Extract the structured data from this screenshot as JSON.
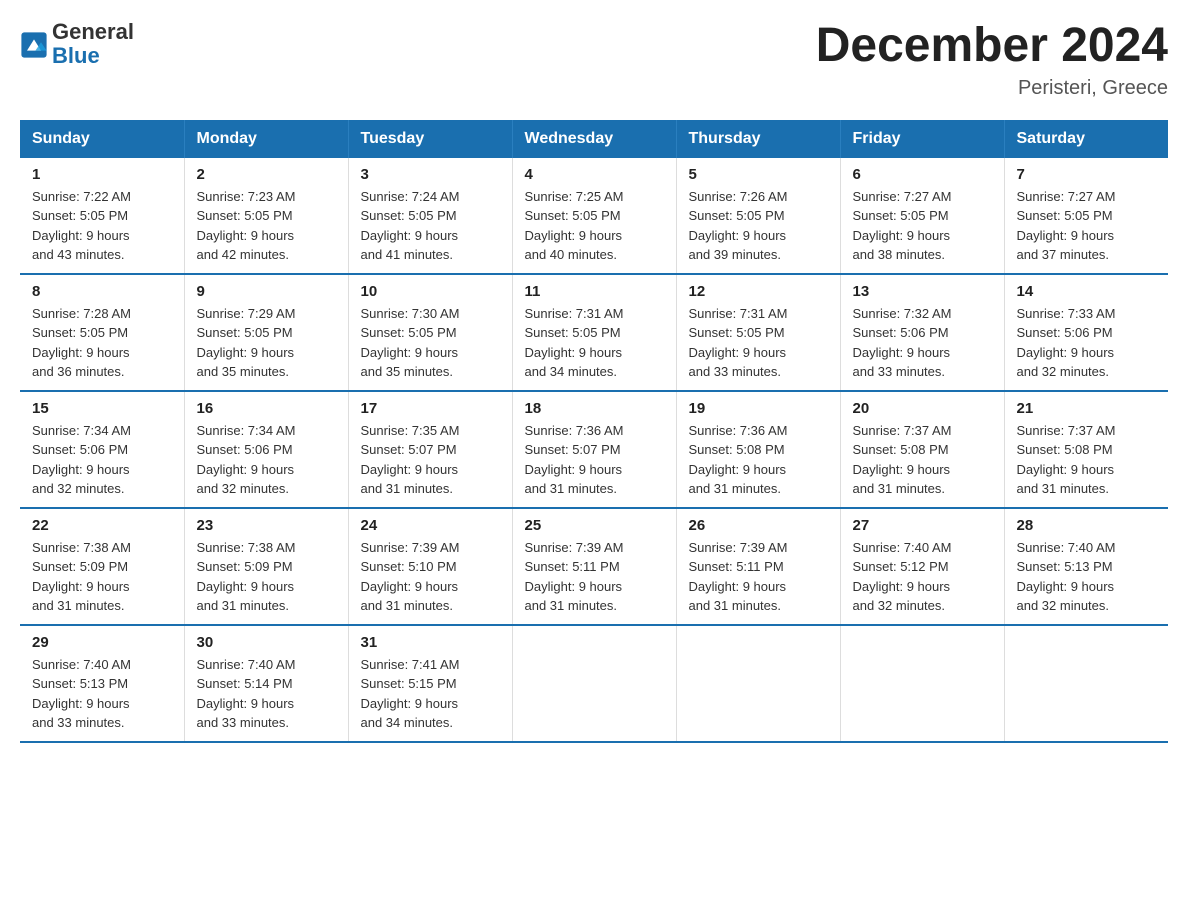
{
  "header": {
    "logo_general": "General",
    "logo_blue": "Blue",
    "month_year": "December 2024",
    "location": "Peristeri, Greece"
  },
  "days_of_week": [
    "Sunday",
    "Monday",
    "Tuesday",
    "Wednesday",
    "Thursday",
    "Friday",
    "Saturday"
  ],
  "weeks": [
    [
      {
        "day": "1",
        "sunrise": "7:22 AM",
        "sunset": "5:05 PM",
        "daylight": "9 hours and 43 minutes."
      },
      {
        "day": "2",
        "sunrise": "7:23 AM",
        "sunset": "5:05 PM",
        "daylight": "9 hours and 42 minutes."
      },
      {
        "day": "3",
        "sunrise": "7:24 AM",
        "sunset": "5:05 PM",
        "daylight": "9 hours and 41 minutes."
      },
      {
        "day": "4",
        "sunrise": "7:25 AM",
        "sunset": "5:05 PM",
        "daylight": "9 hours and 40 minutes."
      },
      {
        "day": "5",
        "sunrise": "7:26 AM",
        "sunset": "5:05 PM",
        "daylight": "9 hours and 39 minutes."
      },
      {
        "day": "6",
        "sunrise": "7:27 AM",
        "sunset": "5:05 PM",
        "daylight": "9 hours and 38 minutes."
      },
      {
        "day": "7",
        "sunrise": "7:27 AM",
        "sunset": "5:05 PM",
        "daylight": "9 hours and 37 minutes."
      }
    ],
    [
      {
        "day": "8",
        "sunrise": "7:28 AM",
        "sunset": "5:05 PM",
        "daylight": "9 hours and 36 minutes."
      },
      {
        "day": "9",
        "sunrise": "7:29 AM",
        "sunset": "5:05 PM",
        "daylight": "9 hours and 35 minutes."
      },
      {
        "day": "10",
        "sunrise": "7:30 AM",
        "sunset": "5:05 PM",
        "daylight": "9 hours and 35 minutes."
      },
      {
        "day": "11",
        "sunrise": "7:31 AM",
        "sunset": "5:05 PM",
        "daylight": "9 hours and 34 minutes."
      },
      {
        "day": "12",
        "sunrise": "7:31 AM",
        "sunset": "5:05 PM",
        "daylight": "9 hours and 33 minutes."
      },
      {
        "day": "13",
        "sunrise": "7:32 AM",
        "sunset": "5:06 PM",
        "daylight": "9 hours and 33 minutes."
      },
      {
        "day": "14",
        "sunrise": "7:33 AM",
        "sunset": "5:06 PM",
        "daylight": "9 hours and 32 minutes."
      }
    ],
    [
      {
        "day": "15",
        "sunrise": "7:34 AM",
        "sunset": "5:06 PM",
        "daylight": "9 hours and 32 minutes."
      },
      {
        "day": "16",
        "sunrise": "7:34 AM",
        "sunset": "5:06 PM",
        "daylight": "9 hours and 32 minutes."
      },
      {
        "day": "17",
        "sunrise": "7:35 AM",
        "sunset": "5:07 PM",
        "daylight": "9 hours and 31 minutes."
      },
      {
        "day": "18",
        "sunrise": "7:36 AM",
        "sunset": "5:07 PM",
        "daylight": "9 hours and 31 minutes."
      },
      {
        "day": "19",
        "sunrise": "7:36 AM",
        "sunset": "5:08 PM",
        "daylight": "9 hours and 31 minutes."
      },
      {
        "day": "20",
        "sunrise": "7:37 AM",
        "sunset": "5:08 PM",
        "daylight": "9 hours and 31 minutes."
      },
      {
        "day": "21",
        "sunrise": "7:37 AM",
        "sunset": "5:08 PM",
        "daylight": "9 hours and 31 minutes."
      }
    ],
    [
      {
        "day": "22",
        "sunrise": "7:38 AM",
        "sunset": "5:09 PM",
        "daylight": "9 hours and 31 minutes."
      },
      {
        "day": "23",
        "sunrise": "7:38 AM",
        "sunset": "5:09 PM",
        "daylight": "9 hours and 31 minutes."
      },
      {
        "day": "24",
        "sunrise": "7:39 AM",
        "sunset": "5:10 PM",
        "daylight": "9 hours and 31 minutes."
      },
      {
        "day": "25",
        "sunrise": "7:39 AM",
        "sunset": "5:11 PM",
        "daylight": "9 hours and 31 minutes."
      },
      {
        "day": "26",
        "sunrise": "7:39 AM",
        "sunset": "5:11 PM",
        "daylight": "9 hours and 31 minutes."
      },
      {
        "day": "27",
        "sunrise": "7:40 AM",
        "sunset": "5:12 PM",
        "daylight": "9 hours and 32 minutes."
      },
      {
        "day": "28",
        "sunrise": "7:40 AM",
        "sunset": "5:13 PM",
        "daylight": "9 hours and 32 minutes."
      }
    ],
    [
      {
        "day": "29",
        "sunrise": "7:40 AM",
        "sunset": "5:13 PM",
        "daylight": "9 hours and 33 minutes."
      },
      {
        "day": "30",
        "sunrise": "7:40 AM",
        "sunset": "5:14 PM",
        "daylight": "9 hours and 33 minutes."
      },
      {
        "day": "31",
        "sunrise": "7:41 AM",
        "sunset": "5:15 PM",
        "daylight": "9 hours and 34 minutes."
      },
      null,
      null,
      null,
      null
    ]
  ],
  "labels": {
    "sunrise_prefix": "Sunrise: ",
    "sunset_prefix": "Sunset: ",
    "daylight_prefix": "Daylight: "
  }
}
